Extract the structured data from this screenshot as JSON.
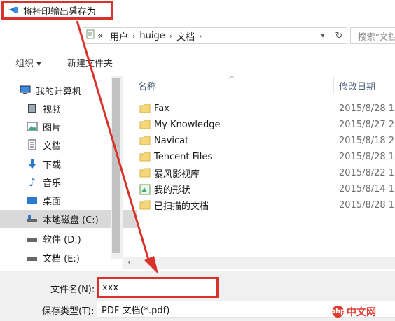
{
  "window": {
    "title": "将打印输出另存为"
  },
  "address": {
    "crumbs": [
      "用户",
      "huige",
      "文档"
    ],
    "search_placeholder": "搜索\"文档\""
  },
  "toolbar": {
    "organize": "组织 ▾",
    "new_folder": "新建文件夹"
  },
  "nav": {
    "items": [
      {
        "label": "我的计算机",
        "icon": "computer-icon"
      },
      {
        "label": "视频",
        "icon": "video-icon"
      },
      {
        "label": "图片",
        "icon": "picture-icon"
      },
      {
        "label": "文档",
        "icon": "document-icon"
      },
      {
        "label": "下载",
        "icon": "download-icon"
      },
      {
        "label": "音乐",
        "icon": "music-icon"
      },
      {
        "label": "桌面",
        "icon": "desktop-icon"
      },
      {
        "label": "本地磁盘 (C:)",
        "icon": "drive-icon"
      },
      {
        "label": "软件 (D:)",
        "icon": "drive-icon"
      },
      {
        "label": "文档 (E:)",
        "icon": "drive-icon"
      }
    ]
  },
  "list": {
    "col_name": "名称",
    "col_date": "修改日期",
    "files": [
      {
        "name": "Fax",
        "date": "2015/8/28 1"
      },
      {
        "name": "My Knowledge",
        "date": "2015/8/27 2"
      },
      {
        "name": "Navicat",
        "date": "2015/8/18 2"
      },
      {
        "name": "Tencent Files",
        "date": "2015/8/28 1"
      },
      {
        "name": "暴风影视库",
        "date": "2015/8/22 1"
      },
      {
        "name": "我的形状",
        "date": "2015/8/14 1"
      },
      {
        "name": "已扫描的文档",
        "date": "2015/8/28 1"
      }
    ]
  },
  "save": {
    "filename_label": "文件名(N):",
    "filename_value": "xxx",
    "filetype_label": "保存类型(T):",
    "filetype_value": "PDF 文档(*.pdf)"
  },
  "watermark": {
    "text": "中文网",
    "badge": "php"
  },
  "colors": {
    "highlight": "#d8322a",
    "selected": "#d9d9d9",
    "panel": "#f0f0f0"
  }
}
